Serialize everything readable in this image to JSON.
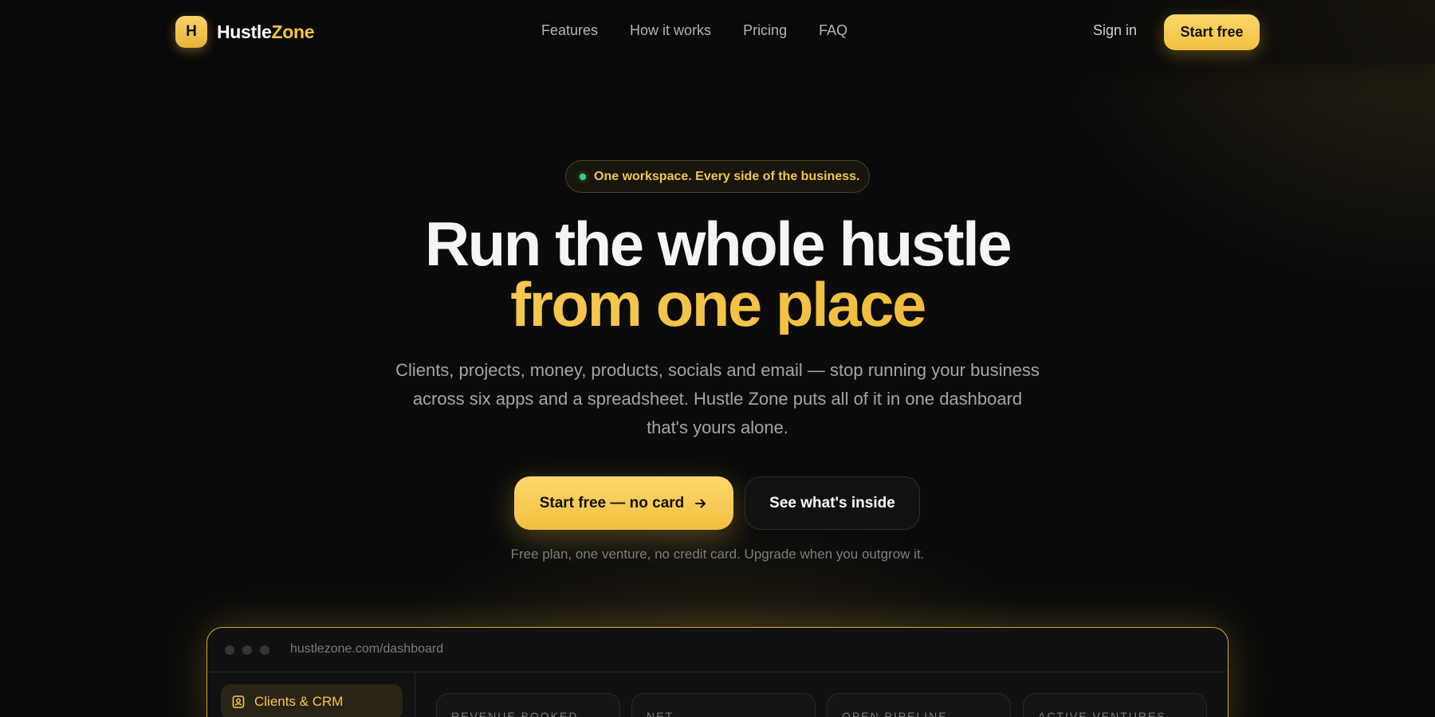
{
  "brand": {
    "logo_letter": "H",
    "name_part1": "Hustle",
    "name_part2": "Zone"
  },
  "nav": {
    "links": [
      "Features",
      "How it works",
      "Pricing",
      "FAQ"
    ],
    "sign_in": "Sign in",
    "start_free": "Start free"
  },
  "hero": {
    "pill_text": "One workspace. Every side of the business.",
    "headline_line1": "Run the whole hustle",
    "headline_line2": "from one place",
    "subtitle": "Clients, projects, money, products, socials and email — stop running your business across six apps and a spreadsheet. Hustle Zone puts all of it in one dashboard that's yours alone.",
    "cta_primary": "Start free — no card",
    "cta_primary_icon": "arrow-right-icon",
    "cta_secondary": "See what's inside",
    "fineprint": "Free plan, one venture, no credit card. Upgrade when you outgrow it."
  },
  "preview": {
    "url": "hustlezone.com/dashboard",
    "sidebar_active": "Clients & CRM",
    "sidebar_active_icon": "contact-card-icon",
    "stats": [
      "Revenue booked",
      "Net",
      "Open pipeline",
      "Active ventures"
    ]
  },
  "colors": {
    "accent": "#f5c542",
    "background": "#0b0b0b",
    "status_dot": "#3ecf7c"
  }
}
